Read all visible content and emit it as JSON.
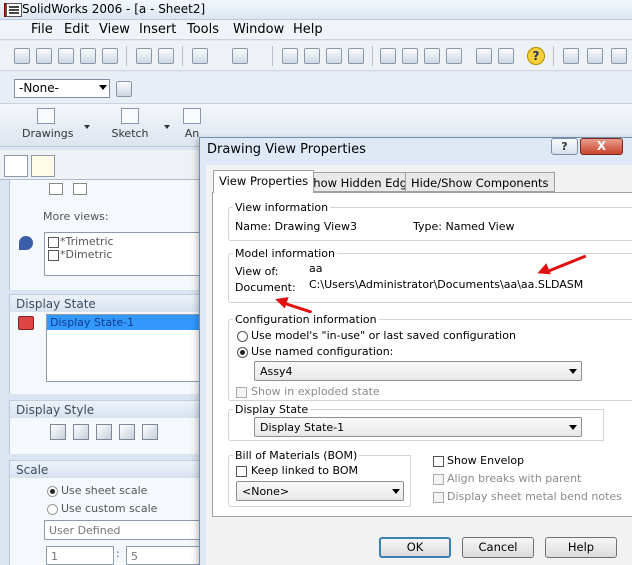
{
  "window": {
    "title": "SolidWorks 2006 - [a - Sheet2]"
  },
  "menu": [
    "File",
    "Edit",
    "View",
    "Insert",
    "Tools",
    "Window",
    "Help"
  ],
  "toolbar": {
    "layer_select": "-None-"
  },
  "command_manager": {
    "tabs": [
      "Drawings",
      "Sketch",
      "An"
    ]
  },
  "left_panel": {
    "more_views_label": "More views:",
    "views": [
      {
        "label": "*Trimetric",
        "checked": false
      },
      {
        "label": "*Dimetric",
        "checked": false
      }
    ],
    "display_state": {
      "header": "Display State",
      "selected": "Display State-1"
    },
    "display_style": {
      "header": "Display Style"
    },
    "scale": {
      "header": "Scale",
      "use_sheet_scale": "Use sheet scale",
      "use_custom_scale": "Use custom scale",
      "user_defined": "User Defined",
      "num": "1",
      "sep": ":",
      "den": "5"
    }
  },
  "dialog": {
    "title": "Drawing View Properties",
    "help_btn": "?",
    "close_btn": "X",
    "tabs": [
      "View Properties",
      "Show Hidden Edges",
      "Hide/Show Components"
    ],
    "view_info": {
      "legend": "View information",
      "name_label": "Name: Drawing View3",
      "type_label": "Type: Named View"
    },
    "model_info": {
      "legend": "Model information",
      "view_of_label": "View of:",
      "view_of_value": "aa",
      "document_label": "Document:",
      "document_value": "C:\\Users\\Administrator\\Documents\\aa\\aa.SLDASM"
    },
    "config_info": {
      "legend": "Configuration information",
      "option_in_use": "Use model's \"in-use\" or last saved configuration",
      "option_named": "Use named configuration:",
      "selected_config": "Assy4",
      "exploded_label": "Show in exploded state"
    },
    "display_state": {
      "legend": "Display State",
      "value": "Display State-1"
    },
    "bom": {
      "legend": "Bill of Materials (BOM)",
      "keep_linked": "Keep linked to BOM",
      "value": "<None>"
    },
    "options": {
      "show_envelop": "Show Envelop",
      "align_breaks": "Align breaks with parent",
      "sheet_metal": "Display sheet metal bend notes"
    },
    "buttons": {
      "ok": "OK",
      "cancel": "Cancel",
      "help": "Help"
    }
  },
  "colors": {
    "annotation_arrow": "#e01010",
    "selection": "#3399ff",
    "close_button": "#c7442b"
  }
}
